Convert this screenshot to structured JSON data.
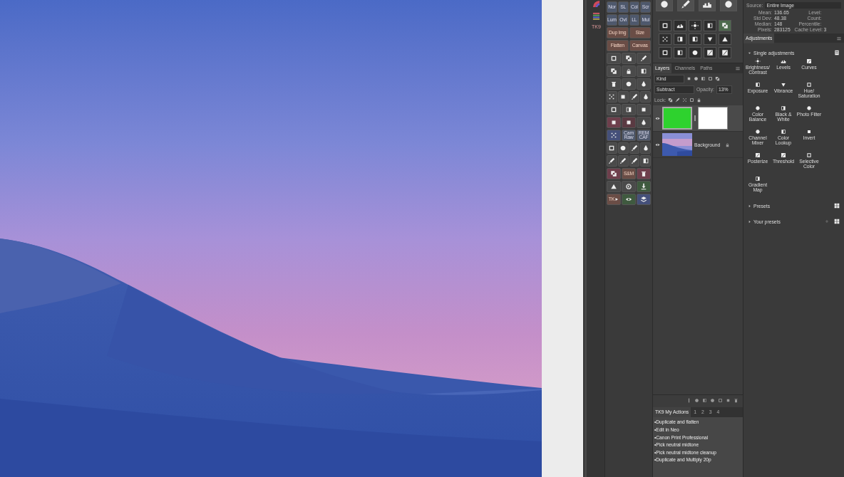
{
  "side_strip": {
    "label": "TK9"
  },
  "tool_panel": {
    "blend_modes": [
      "Nor",
      "SL",
      "Col",
      "Scr",
      "Lum",
      "Ovl",
      "LL",
      "Mul"
    ],
    "actions": [
      "Dup Img",
      "Size",
      "Flatten",
      "Canvas"
    ],
    "raw_buttons": [
      "Cam\nRaw",
      "REM\nCAF"
    ],
    "sm_button": "S&M",
    "tk_button": "TK"
  },
  "histogram": {
    "source_label": "Source:",
    "source": "Entire Image",
    "stats": [
      {
        "label": "Mean:",
        "value": "136.65"
      },
      {
        "label": "Std Dev:",
        "value": "48.38"
      },
      {
        "label": "Median:",
        "value": "148"
      },
      {
        "label": "Pixels:",
        "value": "283125"
      }
    ],
    "stats_right": [
      {
        "label": "Level:"
      },
      {
        "label": "Count:"
      },
      {
        "label": "Percentile:"
      },
      {
        "label": "Cache Level:",
        "value": "3"
      }
    ]
  },
  "layers_panel": {
    "tabs": [
      {
        "label": "Layers",
        "selected": true
      },
      {
        "label": "Channels",
        "selected": false
      },
      {
        "label": "Paths",
        "selected": false
      }
    ],
    "filter": "Kind",
    "blend_mode": "Subtract",
    "opacity_label": "Opacity:",
    "opacity": "13%",
    "lock_label": "Lock:",
    "layers": [
      {
        "kind": "fill",
        "selected": true,
        "visible": true,
        "locked": false
      },
      {
        "name": "Background",
        "selected": false,
        "visible": true,
        "locked": true
      }
    ]
  },
  "actions_panel": {
    "tabs": [
      {
        "label": "TK9 My Actions",
        "selected": true
      },
      {
        "label": "1",
        "selected": false
      },
      {
        "label": "2",
        "selected": false
      },
      {
        "label": "3",
        "selected": false
      },
      {
        "label": "4",
        "selected": false
      }
    ],
    "items": [
      "•Duplicate and flatten",
      "•Edit in Neo",
      "•Canon Print Professional",
      "•Pick neutral midtone",
      "•Pick neutral midtone cleanup",
      "•Duplicate and Multiply 20p"
    ]
  },
  "adjustments_panel": {
    "tab": "Adjustments",
    "sections": [
      {
        "label": "Single adjustments",
        "expanded": true,
        "items": [
          "Brightness/\nContrast",
          "Levels",
          "Curves",
          "Exposure",
          "Vibrance",
          "Hue/\nSaturation",
          "Color\nBalance",
          "Black &\nWhite",
          "Photo Filter",
          "Channel\nMixer",
          "Color\nLookup",
          "Invert",
          "Posterize",
          "Threshold",
          "Selective\nColor",
          "Gradient\nMap"
        ]
      },
      {
        "label": "Presets",
        "expanded": false
      },
      {
        "label": "Your presets",
        "expanded": false
      }
    ]
  }
}
